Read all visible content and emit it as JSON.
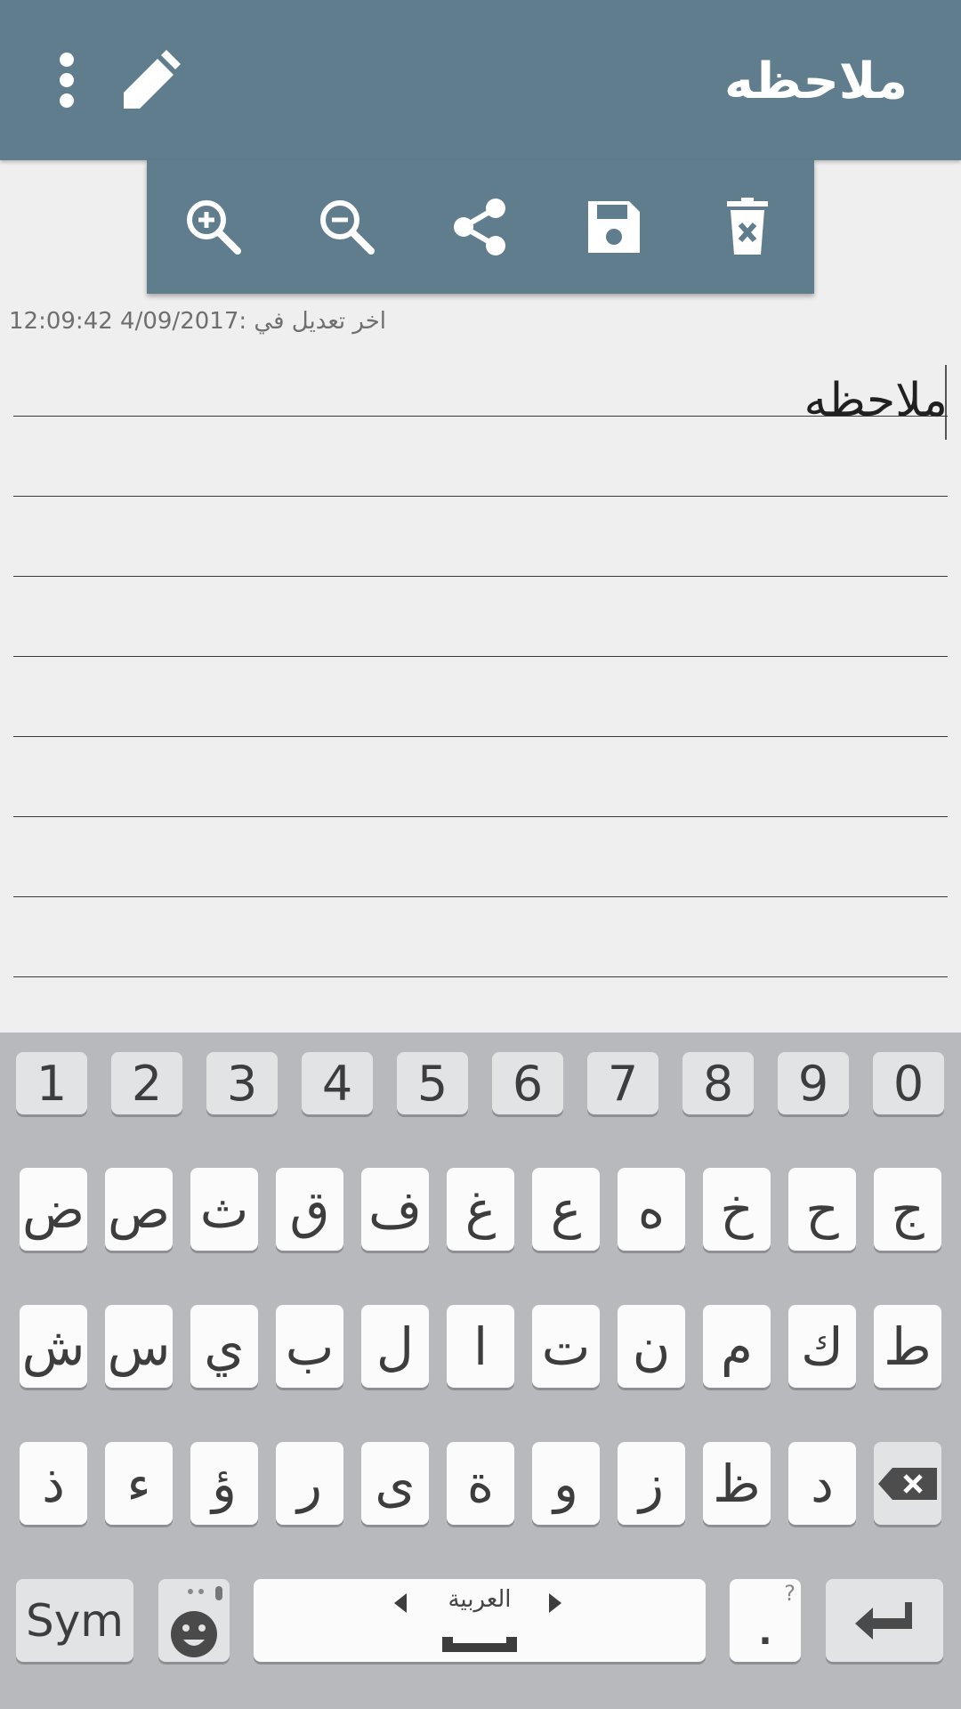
{
  "app": {
    "title": "ملاحظه"
  },
  "toolbar": {
    "zoom_in_icon": "zoom-in-icon",
    "zoom_out_icon": "zoom-out-icon",
    "share_icon": "share-icon",
    "save_icon": "save-icon",
    "delete_icon": "delete-icon"
  },
  "note": {
    "last_modified": "اخر تعديل في :4/09/2017 12:09:42",
    "text": "ملاحظه"
  },
  "keyboard": {
    "numbers": [
      "1",
      "2",
      "3",
      "4",
      "5",
      "6",
      "7",
      "8",
      "9",
      "0"
    ],
    "row1": [
      "ض",
      "ص",
      "ث",
      "ق",
      "ف",
      "غ",
      "ع",
      "ه",
      "خ",
      "ح",
      "ج"
    ],
    "row2": [
      "ش",
      "س",
      "ي",
      "ب",
      "ل",
      "ا",
      "ت",
      "ن",
      "م",
      "ك",
      "ط"
    ],
    "row3": [
      "ذ",
      "ء",
      "ؤ",
      "ر",
      "ى",
      "ة",
      "و",
      "ز",
      "ظ",
      "د"
    ],
    "sym_label": "Sym",
    "language_label": "العربية",
    "period_label": ".",
    "period_hint": "?"
  },
  "colors": {
    "appbar": "#607d8e",
    "background": "#efefef",
    "keyboard": "#b7b9bc"
  }
}
